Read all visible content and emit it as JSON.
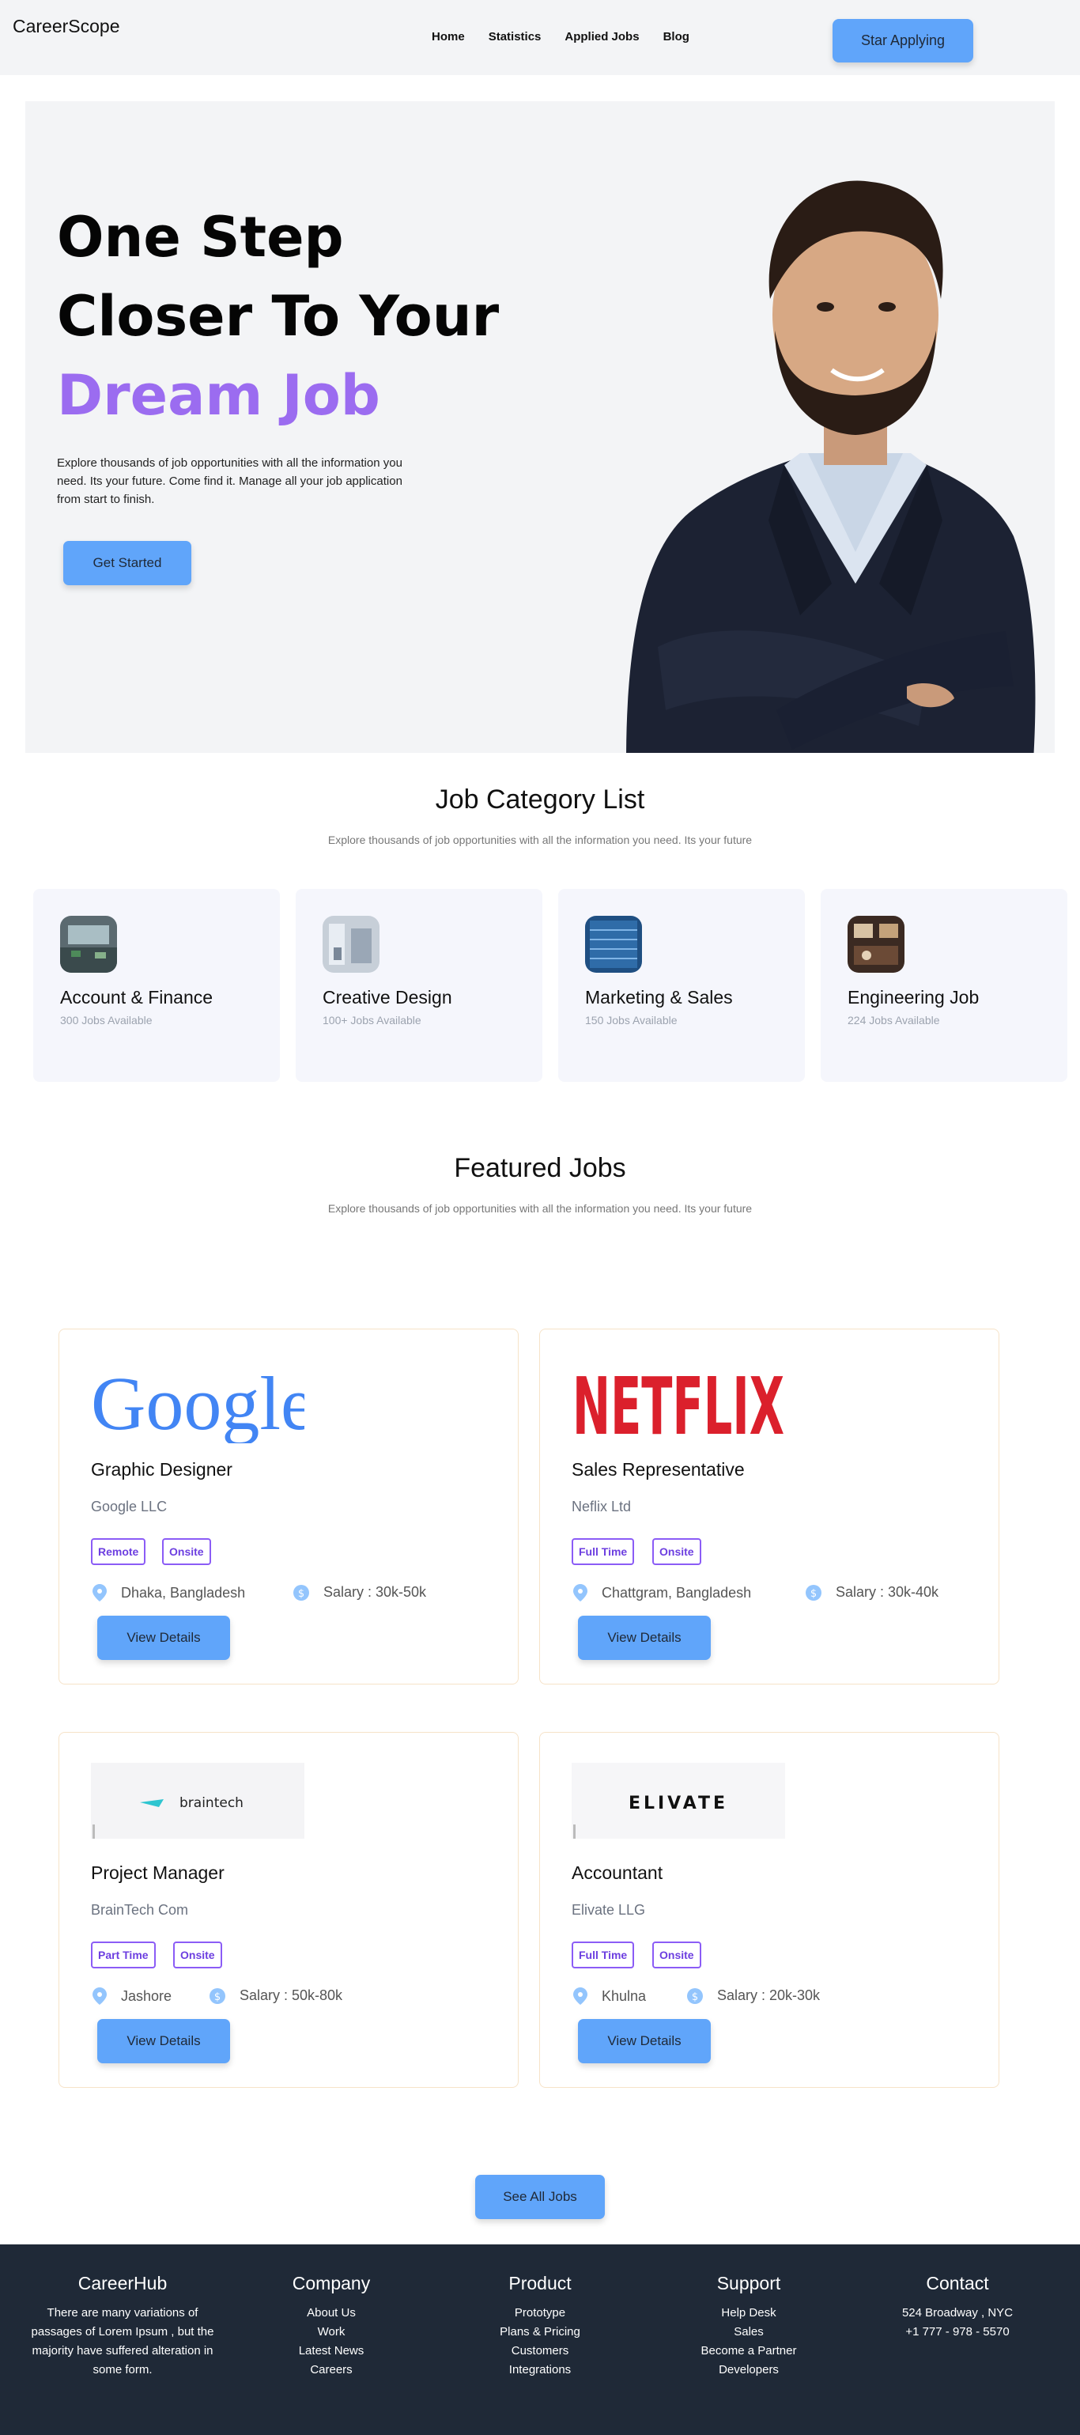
{
  "nav": {
    "brand": "CareerScope",
    "links": [
      "Home",
      "Statistics",
      "Applied Jobs",
      "Blog"
    ],
    "cta": "Star Applying"
  },
  "hero": {
    "line1": "One Step",
    "line2": "Closer To Your",
    "accent": "Dream Job",
    "description": "Explore thousands of job opportunities with all the information you need. Its your future. Come find it. Manage all your job application from start to finish.",
    "button": "Get Started",
    "accent_color": "#9b6cf0"
  },
  "categories": {
    "title": "Job Category List",
    "subtitle": "Explore thousands of job opportunities with all the information you need. Its your future",
    "items": [
      {
        "name": "Account & Finance",
        "count": "300 Jobs Available"
      },
      {
        "name": "Creative Design",
        "count": "100+ Jobs Available"
      },
      {
        "name": "Marketing & Sales",
        "count": "150 Jobs Available"
      },
      {
        "name": "Engineering Job",
        "count": "224 Jobs Available"
      }
    ]
  },
  "featured": {
    "title": "Featured Jobs",
    "subtitle": "Explore thousands of job opportunities with all the information you need. Its your future",
    "jobs": [
      {
        "logo": "Google",
        "title": "Graphic Designer",
        "company": "Google LLC",
        "tags": [
          "Remote",
          "Onsite"
        ],
        "location": "Dhaka, Bangladesh",
        "salary": "Salary : 30k-50k",
        "button": "View Details"
      },
      {
        "logo": "NETFLIX",
        "title": "Sales Representative",
        "company": "Neflix Ltd",
        "tags": [
          "Full Time",
          "Onsite"
        ],
        "location": "Chattgram, Bangladesh",
        "salary": "Salary : 30k-40k",
        "button": "View Details"
      },
      {
        "logo": "braintech",
        "title": "Project Manager",
        "company": "BrainTech Com",
        "tags": [
          "Part Time",
          "Onsite"
        ],
        "location": "Jashore",
        "salary": "Salary : 50k-80k",
        "button": "View Details"
      },
      {
        "logo": "ELIVATE",
        "title": "Accountant",
        "company": "Elivate LLG",
        "tags": [
          "Full Time",
          "Onsite"
        ],
        "location": "Khulna",
        "salary": "Salary : 20k-30k",
        "button": "View Details"
      }
    ],
    "see_all": "See All Jobs"
  },
  "footer": {
    "brand": {
      "title": "CareerHub",
      "text": [
        "There are many variations of",
        "passages of Lorem Ipsum , but the",
        "majority have suffered alteration in",
        "some form."
      ]
    },
    "company": {
      "title": "Company",
      "links": [
        "About Us",
        "Work",
        "Latest News",
        "Careers"
      ]
    },
    "product": {
      "title": "Product",
      "links": [
        "Prototype",
        "Plans & Pricing",
        "Customers",
        "Integrations"
      ]
    },
    "support": {
      "title": "Support",
      "links": [
        "Help Desk",
        "Sales",
        "Become a Partner",
        "Developers"
      ]
    },
    "contact": {
      "title": "Contact",
      "lines": [
        "524 Broadway , NYC",
        "+1 777 - 978 - 5570"
      ]
    }
  }
}
